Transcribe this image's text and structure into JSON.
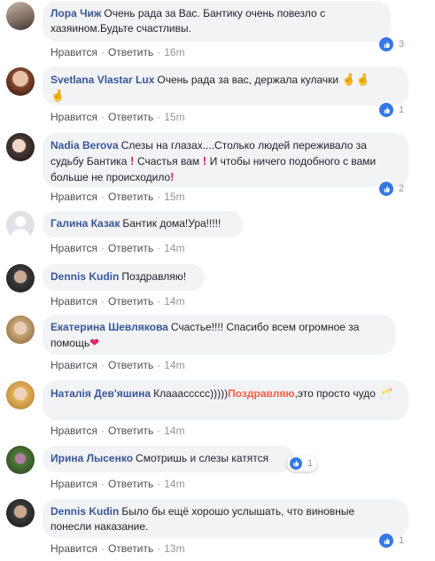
{
  "comments": [
    {
      "author": "Лора Чиж",
      "text": "Очень рада за Вас. Бантику очень повезло с хазяином.Будьте счастливы.",
      "like": "Нравится",
      "reply": "Ответить",
      "time": "16m",
      "reactions": "3"
    },
    {
      "author": "Svetlana Vlastar Lux",
      "text": "Очень рада за вас, держала кулачки",
      "like": "Нравится",
      "reply": "Ответить",
      "time": "15m",
      "reactions": "1"
    },
    {
      "author": "Nadia Berova",
      "text": "Слезы на глазах....Столько людей переживало за судьбу Бантика",
      "text2": "Счастья вам",
      "text3": "И чтобы ничего подобного с вами больше не происходило",
      "like": "Нравится",
      "reply": "Ответить",
      "time": "15m",
      "reactions": "2"
    },
    {
      "author": "Галина Казак",
      "text": "Бантик дома!Ура!!!!!",
      "like": "Нравится",
      "reply": "Ответить",
      "time": "14m"
    },
    {
      "author": "Dennis Kudin",
      "text": "Поздравляю!",
      "like": "Нравится",
      "reply": "Ответить",
      "time": "14m"
    },
    {
      "author": "Екатерина Шевлякова",
      "text": "Счастье!!!! Спасибо всем огромное за помощь",
      "like": "Нравится",
      "reply": "Ответить",
      "time": "14m"
    },
    {
      "author": "Наталія Дев'яшина",
      "text": "Клааассссс)))))",
      "highlight": "Поздравляю",
      "text2": ",это просто чудо",
      "like": "Нравится",
      "reply": "Ответить",
      "time": "14m"
    },
    {
      "author": "Ирина Лысенко",
      "text": "Смотришь и слезы катятся",
      "like": "Нравится",
      "reply": "Ответить",
      "time": "14m",
      "reactions": "1"
    },
    {
      "author": "Dennis Kudin",
      "text": "Было бы ещё хорошо услышать, что виновные понесли наказание.",
      "like": "Нравится",
      "reply": "Ответить",
      "time": "13m",
      "reactions": "1"
    }
  ],
  "icons": {
    "like": "thumbs-up-icon",
    "hand": "crossed-fingers-emoji",
    "heart": "red-heart-emoji",
    "exclaim": "exclamation-emoji",
    "cheers": "clinking-glasses-emoji"
  },
  "colors": {
    "author": "#385898",
    "bubble": "#f2f3f5",
    "like_badge": "#3578e5",
    "highlight": "#f7604a"
  }
}
